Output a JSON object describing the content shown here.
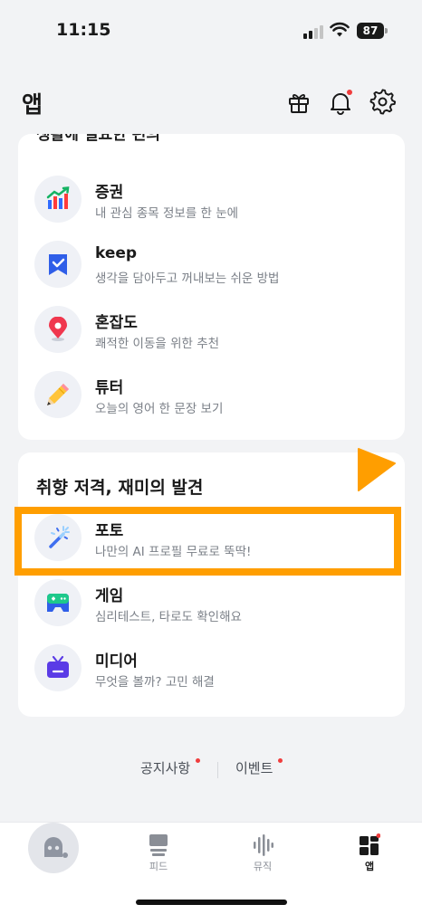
{
  "status_bar": {
    "time": "11:15",
    "battery": "87"
  },
  "header": {
    "title": "앱",
    "icons": [
      "gift-icon",
      "bell-icon",
      "gear-icon"
    ],
    "has_notification": true
  },
  "card_top": {
    "clipped_heading": "생활에 필요한 편의",
    "items": [
      {
        "title": "증권",
        "desc": "내 관심 종목 정보를 한 눈에",
        "icon": "stock-chart-icon"
      },
      {
        "title": "keep",
        "desc": "생각을 담아두고 꺼내보는 쉬운 방법",
        "icon": "bookmark-icon"
      },
      {
        "title": "혼잡도",
        "desc": "쾌적한 이동을 위한 추천",
        "icon": "location-pin-icon"
      },
      {
        "title": "튜터",
        "desc": "오늘의 영어 한 문장 보기",
        "icon": "pencil-icon"
      }
    ]
  },
  "card_bottom": {
    "section_title": "취향 저격, 재미의 발견",
    "items": [
      {
        "title": "포토",
        "desc": "나만의 AI 프로필 무료로 뚝딱!",
        "icon": "magic-wand-icon"
      },
      {
        "title": "게임",
        "desc": "심리테스트, 타로도 확인해요",
        "icon": "game-controller-icon"
      },
      {
        "title": "미디어",
        "desc": "무엇을 볼까? 고민 해결",
        "icon": "tv-icon"
      }
    ]
  },
  "footer_links": [
    "공지사항",
    "이벤트"
  ],
  "tab_bar": {
    "tabs": [
      {
        "label": "피드",
        "icon": "feed-icon",
        "active": false
      },
      {
        "label": "뮤직",
        "icon": "music-icon",
        "active": false
      },
      {
        "label": "앱",
        "icon": "apps-icon",
        "active": true
      }
    ]
  },
  "colors": {
    "accent_orange": "#ff9e00",
    "notification_red": "#f03d3d",
    "background": "#f2f3f5"
  }
}
